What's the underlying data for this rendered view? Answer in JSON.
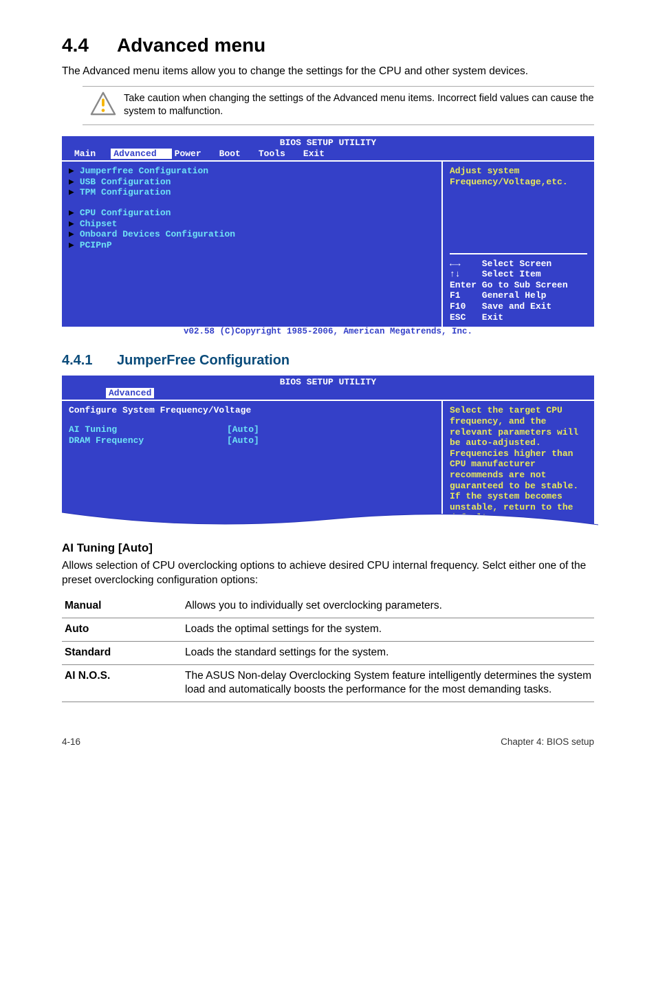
{
  "heading": {
    "num": "4.4",
    "title": "Advanced menu"
  },
  "intro": "The Advanced menu items allow you to change the settings for the CPU and other system devices.",
  "callout": "Take caution when changing the settings of the Advanced menu items. Incorrect field values can cause the system to malfunction.",
  "bios1": {
    "title": "BIOS SETUP UTILITY",
    "menu": [
      "Main",
      "Advanced",
      "Power",
      "Boot",
      "Tools",
      "Exit"
    ],
    "items_group1": [
      "Jumperfree Configuration",
      "USB Configuration",
      "TPM Configuration"
    ],
    "items_group2": [
      "CPU Configuration",
      "Chipset",
      "Onboard Devices Configuration",
      "PCIPnP"
    ],
    "help": "Adjust system\nFrequency/Voltage,etc.",
    "keys": [
      "←→    Select Screen",
      "↑↓    Select Item",
      "Enter Go to Sub Screen",
      "F1    General Help",
      "F10   Save and Exit",
      "ESC   Exit"
    ],
    "footer": "v02.58 (C)Copyright 1985-2006, American Megatrends, Inc."
  },
  "subheading": {
    "num": "4.4.1",
    "title": "JumperFree Configuration"
  },
  "bios2": {
    "title": "BIOS SETUP UTILITY",
    "menu_sel": "Advanced",
    "heading": "Configure System Frequency/Voltage",
    "rows": [
      {
        "lbl": "AI Tuning",
        "val": "[Auto]"
      },
      {
        "lbl": "DRAM Frequency",
        "val": "[Auto]"
      }
    ],
    "help": "Select the target CPU frequency, and the relevant parameters will be auto-adjusted. Frequencies higher than CPU manufacturer recommends are not guaranteed to be stable. If the system becomes unstable, return to the default."
  },
  "section3": {
    "title": "AI Tuning [Auto]",
    "intro": "Allows selection of CPU overclocking options to achieve desired CPU internal frequency. Selct either one of the preset overclocking configuration options:",
    "defs": [
      {
        "lbl": "Manual",
        "desc": "Allows you to individually set overclocking parameters."
      },
      {
        "lbl": "Auto",
        "desc": "Loads the optimal settings for the system."
      },
      {
        "lbl": "Standard",
        "desc": "Loads the standard settings for the system."
      },
      {
        "lbl": "AI N.O.S.",
        "desc": "The ASUS Non-delay Overclocking System feature intelligently determines the system load and automatically boosts the performance for the most demanding tasks."
      }
    ]
  },
  "footer": {
    "left": "4-16",
    "right": "Chapter 4: BIOS setup"
  }
}
